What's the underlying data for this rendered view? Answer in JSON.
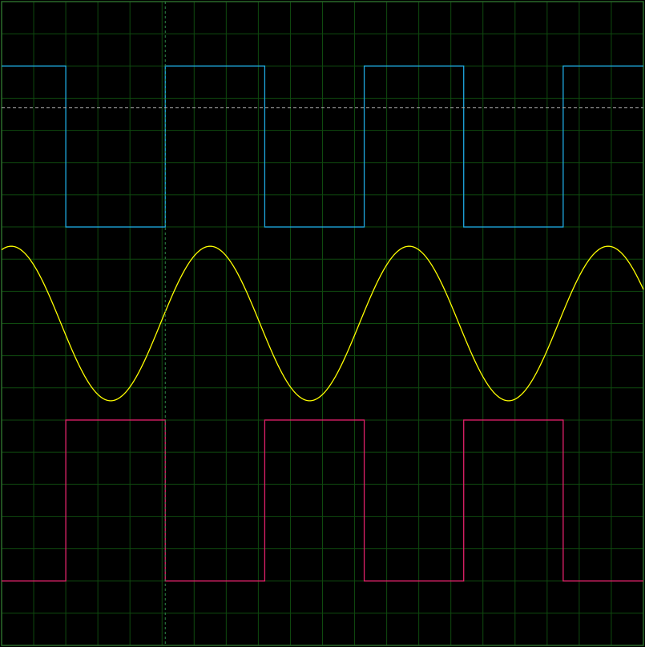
{
  "chart_data": {
    "type": "line",
    "title": "",
    "xlabel": "",
    "ylabel": "",
    "grid": true,
    "colors": {
      "background": "#000000",
      "grid": "#0f4a0f",
      "border": "#2a6a2a",
      "cursor": "#2f8a4a",
      "reference": "#b0b0b0",
      "square_top": "#1ea8e0",
      "sine": "#ffff00",
      "square_bottom": "#e0206a"
    },
    "grid_divisions": {
      "x": 20,
      "y": 20
    },
    "xlim": [
      0,
      20
    ],
    "ylim": [
      0,
      20
    ],
    "cursor_x": 5.1,
    "reference_y": 16.7,
    "series": [
      {
        "kind": "square",
        "color_key": "square_top",
        "high": 18.0,
        "low": 13.0,
        "transitions": [
          0,
          2.0,
          5.1,
          8.2,
          11.3,
          14.4,
          17.5,
          20.0
        ],
        "start_high": true
      },
      {
        "kind": "sine",
        "color_key": "sine",
        "offset": 10.0,
        "amplitude": 2.4,
        "period": 6.2,
        "peak_x": 6.5
      },
      {
        "kind": "square",
        "color_key": "square_bottom",
        "high": 7.0,
        "low": 2.0,
        "transitions": [
          0,
          2.0,
          5.1,
          8.2,
          11.3,
          14.4,
          17.5,
          20.0
        ],
        "start_high": false
      }
    ]
  }
}
